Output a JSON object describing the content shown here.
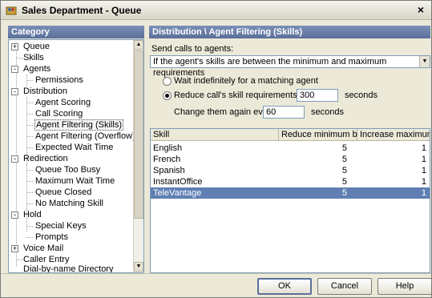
{
  "window": {
    "title": "Sales Department - Queue",
    "close_glyph": "×",
    "icon": "app-icon"
  },
  "category": {
    "header": "Category",
    "items": [
      {
        "label": "Queue",
        "expander": "+"
      },
      {
        "label": "Skills"
      },
      {
        "label": "Agents",
        "expander": "-"
      },
      {
        "label": "Permissions"
      },
      {
        "label": "Distribution",
        "expander": "-"
      },
      {
        "label": "Agent Scoring"
      },
      {
        "label": "Call Scoring"
      },
      {
        "label": "Agent Filtering (Skills)",
        "selected": true
      },
      {
        "label": "Agent Filtering (Overflow)"
      },
      {
        "label": "Expected Wait Time"
      },
      {
        "label": "Redirection",
        "expander": "-"
      },
      {
        "label": "Queue Too Busy"
      },
      {
        "label": "Maximum Wait Time"
      },
      {
        "label": "Queue Closed"
      },
      {
        "label": "No Matching Skill"
      },
      {
        "label": "Hold",
        "expander": "-"
      },
      {
        "label": "Special Keys"
      },
      {
        "label": "Prompts"
      },
      {
        "label": "Voice Mail",
        "expander": "+"
      },
      {
        "label": "Caller Entry"
      },
      {
        "label": "Dial-by-name Directory"
      }
    ]
  },
  "panel": {
    "header": "Distribution \\ Agent Filtering (Skills)",
    "send_label": "Send calls to agents:",
    "send_select_value": "If the agent's skills are between the minimum and maximum requirements",
    "option_wait_label": "Wait indefinitely for a matching agent",
    "option_reduce_label": "Reduce call's skill requirements after",
    "reduce_after_value": "300",
    "seconds_label_1": "seconds",
    "change_label": "Change them again every",
    "change_every_value": "60",
    "seconds_label_2": "seconds"
  },
  "table": {
    "columns": [
      "Skill",
      "Reduce minimum by",
      "Increase maximum by"
    ],
    "rows": [
      {
        "skill": "English",
        "reduce": "5",
        "increase": "1"
      },
      {
        "skill": "French",
        "reduce": "5",
        "increase": "1"
      },
      {
        "skill": "Spanish",
        "reduce": "5",
        "increase": "1"
      },
      {
        "skill": "InstantOffice",
        "reduce": "5",
        "increase": "1"
      },
      {
        "skill": "TeleVantage",
        "reduce": "5",
        "increase": "1",
        "selected": true
      }
    ]
  },
  "buttons": {
    "ok": "OK",
    "cancel": "Cancel",
    "help": "Help"
  }
}
